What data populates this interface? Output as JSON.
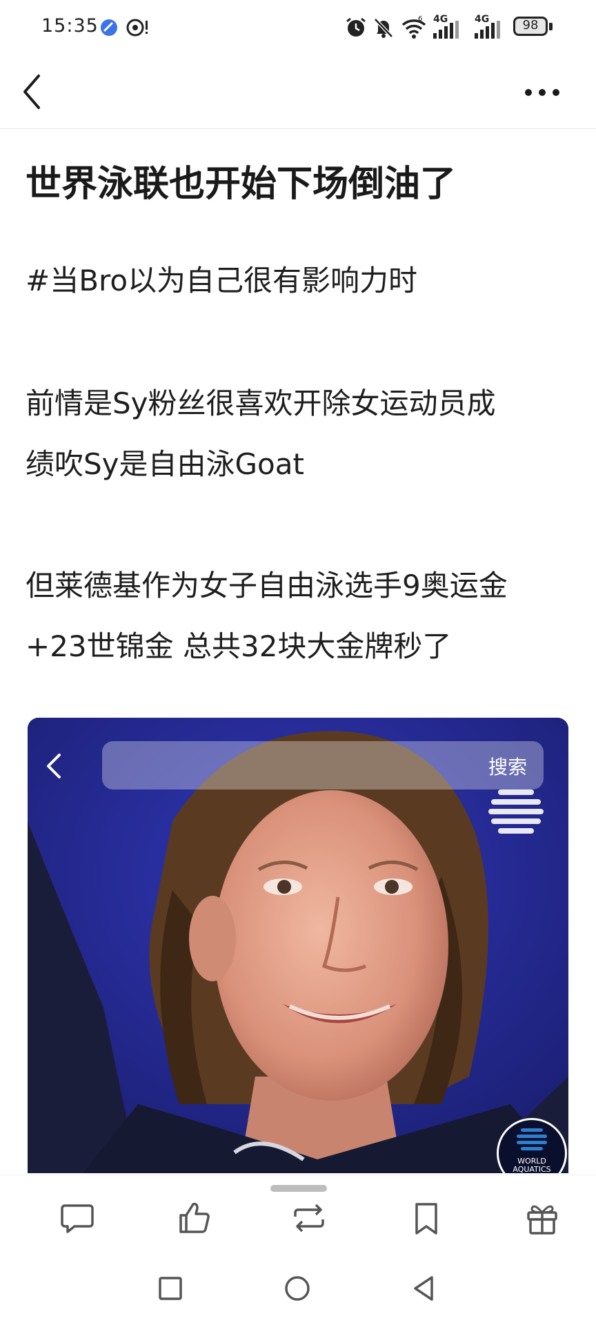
{
  "status_bar": {
    "time": "15:35",
    "signal_1_label": "4G",
    "signal_2_label": "4G",
    "battery": "98",
    "icons": [
      "app-badge-icon",
      "notification-icon",
      "alarm-icon",
      "mute-icon",
      "wifi-icon",
      "signal-icon",
      "signal-icon",
      "battery-icon"
    ]
  },
  "nav": {
    "back_icon": "chevron-left-icon",
    "more_icon": "more-horizontal-icon"
  },
  "article": {
    "title": "世界泳联也开始下场倒油了",
    "para1": "#当Bro以为自己很有影响力时",
    "para2_line1": "前情是Sy粉丝很喜欢开除女运动员成",
    "para2_line2": "绩吹Sy是自由泳Goat",
    "para3_line1": "但莱德基作为女子自由泳选手9奥运金",
    "para3_line2": "+23世锦金 总共32块大金牌秒了"
  },
  "image": {
    "search_label": "搜索",
    "logo_text_line1": "WORLD",
    "logo_text_line2": "AQUATICS"
  },
  "action_bar": {
    "icons": [
      "comment-icon",
      "like-icon",
      "repost-icon",
      "bookmark-icon",
      "gift-icon"
    ]
  },
  "system_nav": {
    "icons": [
      "recent-apps-icon",
      "home-icon",
      "back-icon"
    ]
  },
  "colors": {
    "photo_bg": "#23288c",
    "text": "#1e1e1e",
    "icon": "#555555"
  }
}
